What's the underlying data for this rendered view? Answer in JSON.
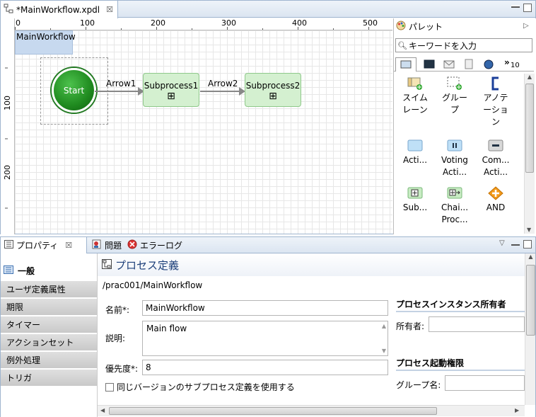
{
  "editor": {
    "tab_title": "*MainWorkflow.xpdl",
    "close_glyph": "☒"
  },
  "ruler": {
    "top_ticks": [
      "0",
      "100",
      "200",
      "300",
      "400",
      "500"
    ],
    "left_ticks": [
      "100",
      "200"
    ]
  },
  "diagram": {
    "label": "MainWorkflow",
    "start": "Start",
    "nodes": [
      "Subprocess1",
      "Subprocess2"
    ],
    "arrows": [
      "Arrow1",
      "Arrow2"
    ],
    "expand_glyph": "⊞"
  },
  "palette": {
    "title": "パレット",
    "search_placeholder": "キーワードを入力",
    "more_count": "10",
    "more_glyph": "»",
    "items": [
      "スイム\nレーン",
      "グルー\nプ",
      "アノテ\nーショ\nン",
      "Acti...",
      "Voting\nActi...",
      "Com...\nActi...",
      "Sub...",
      "Chai...\nProc...",
      "AND"
    ]
  },
  "props": {
    "tabs": [
      "プロパティ",
      "問題",
      "エラーログ"
    ],
    "categories": [
      "一般",
      "ユーザ定義属性",
      "期限",
      "タイマー",
      "アクションセット",
      "例外処理",
      "トリガ"
    ],
    "section_title": "プロセス定義",
    "path": "/prac001/MainWorkflow",
    "name_label": "名前*:",
    "name_value": "MainWorkflow",
    "desc_label": "説明:",
    "desc_value": "Main flow",
    "priority_label": "優先度*:",
    "priority_value": "8",
    "checkbox_label": "同じバージョンのサブプロセス定義を使用する",
    "owner_header": "プロセスインスタンス所有者",
    "owner_label": "所有者:",
    "perm_header": "プロセス起動権限",
    "group_label": "グループ名:"
  },
  "colors": {
    "accent": "#3a6fb0",
    "start_green": "#1f8a1f",
    "node_fill": "#d4f0d0"
  }
}
